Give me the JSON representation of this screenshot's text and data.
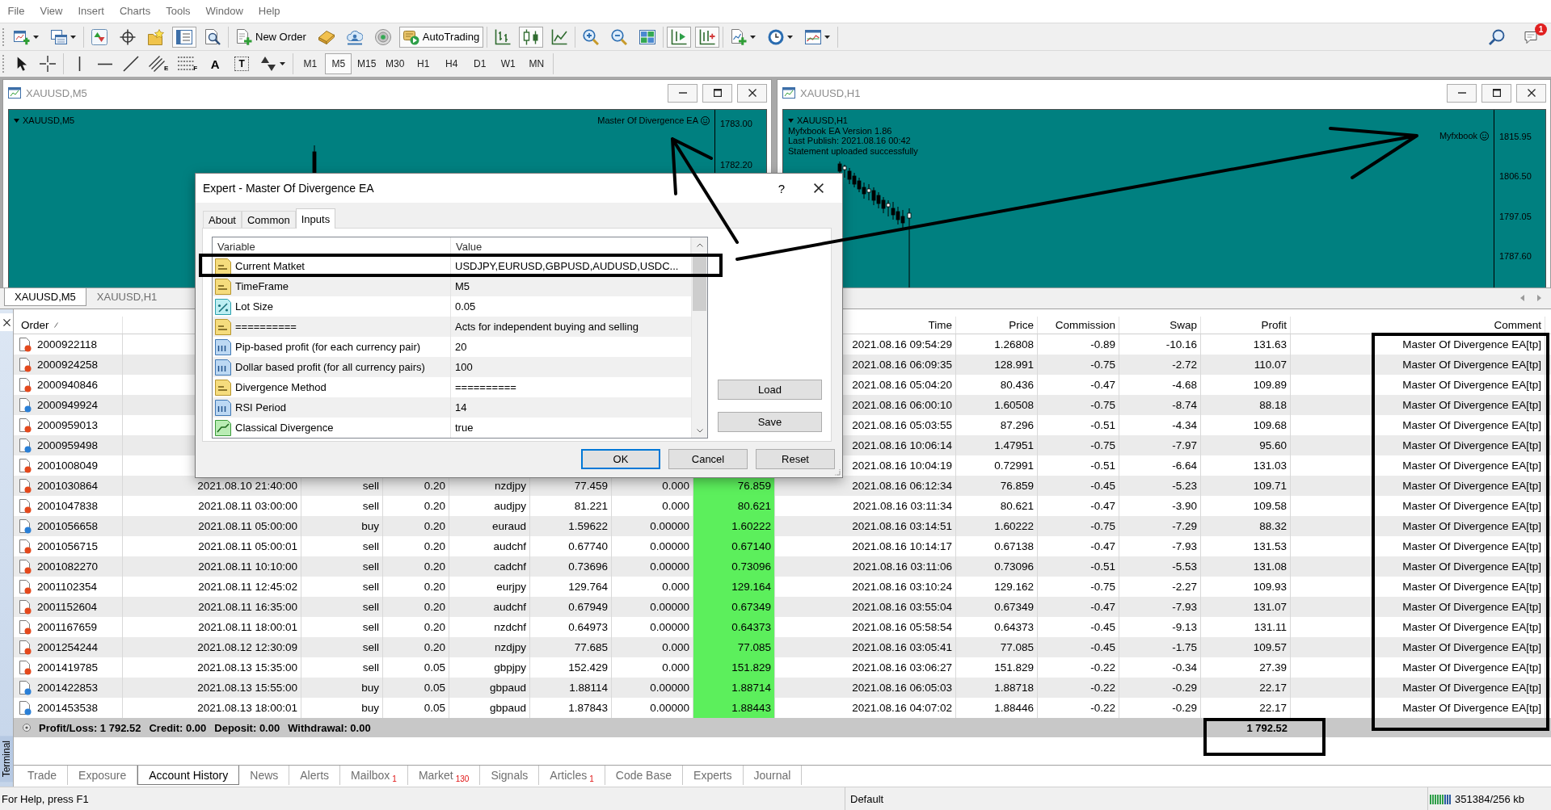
{
  "menu": [
    "File",
    "View",
    "Insert",
    "Charts",
    "Tools",
    "Window",
    "Help"
  ],
  "toolbar": {
    "groups": [
      [
        {
          "kind": "new-chart",
          "menu": true,
          "pressed": false
        },
        {
          "kind": "profiles",
          "menu": true,
          "pressed": false
        }
      ],
      [
        {
          "kind": "market-watch",
          "pressed": false
        },
        {
          "kind": "data-window",
          "pressed": false
        },
        {
          "kind": "navigator",
          "pressed": false
        },
        {
          "kind": "terminal",
          "pressed": true
        },
        {
          "kind": "tester",
          "pressed": false
        }
      ],
      [
        {
          "kind": "new-order",
          "label": "New Order",
          "pressed": false
        },
        {
          "kind": "editor",
          "pressed": false
        },
        {
          "kind": "signals",
          "pressed": false
        },
        {
          "kind": "radar",
          "pressed": false
        },
        {
          "kind": "autotrading",
          "label": "AutoTrading",
          "pressed": true
        }
      ],
      [
        {
          "kind": "bar-chart",
          "pressed": false
        },
        {
          "kind": "candles",
          "pressed": true
        },
        {
          "kind": "line-chart",
          "pressed": false
        }
      ],
      [
        {
          "kind": "zoom-in",
          "pressed": false
        },
        {
          "kind": "zoom-out",
          "pressed": false
        },
        {
          "kind": "tile",
          "pressed": false
        }
      ],
      [
        {
          "kind": "auto-scroll",
          "pressed": true
        },
        {
          "kind": "chart-shift",
          "pressed": true
        }
      ],
      [
        {
          "kind": "indicators",
          "menu": true,
          "pressed": false
        },
        {
          "kind": "periods",
          "menu": true,
          "pressed": false
        },
        {
          "kind": "templates",
          "menu": true,
          "pressed": false
        }
      ]
    ],
    "right": [
      {
        "kind": "search"
      },
      {
        "kind": "notifications",
        "badge": "1"
      }
    ]
  },
  "drawing_tools": {
    "groups": [
      [
        {
          "kind": "cursor"
        },
        {
          "kind": "crosshair"
        }
      ],
      [
        {
          "kind": "vertical-line"
        },
        {
          "kind": "horizontal-line"
        },
        {
          "kind": "trend-line"
        },
        {
          "kind": "channel",
          "glyph": "E"
        },
        {
          "kind": "fibonacci",
          "glyph": "F"
        },
        {
          "kind": "text",
          "glyph": "A"
        },
        {
          "kind": "label",
          "glyph": "T"
        },
        {
          "kind": "arrows",
          "menu": true
        }
      ]
    ]
  },
  "timeframes": [
    {
      "label": "M1",
      "selected": false
    },
    {
      "label": "M5",
      "selected": true
    },
    {
      "label": "M15",
      "selected": false
    },
    {
      "label": "M30",
      "selected": false
    },
    {
      "label": "H1",
      "selected": false
    },
    {
      "label": "H4",
      "selected": false
    },
    {
      "label": "D1",
      "selected": false
    },
    {
      "label": "W1",
      "selected": false
    },
    {
      "label": "MN",
      "selected": false
    }
  ],
  "chart_windows": [
    {
      "title": "XAUUSD,M5",
      "symbol": "XAUUSD,M5",
      "expert": "Master Of Divergence EA",
      "price_labels": [
        "1783.00",
        "1782.20"
      ]
    },
    {
      "title": "XAUUSD,H1",
      "symbol": "XAUUSD,H1",
      "info_lines": [
        "Myfxbook EA Version 1.86",
        "Last Publish: 2021.08.16 00:42",
        "Statement uploaded successfully"
      ],
      "expert": "Myfxbook",
      "price_labels": [
        "1815.95",
        "1806.50",
        "1797.05",
        "1787.60"
      ]
    }
  ],
  "chart_tabs": [
    {
      "label": "XAUUSD,M5",
      "selected": true
    },
    {
      "label": "XAUUSD,H1",
      "selected": false
    }
  ],
  "terminal": {
    "title": "Terminal",
    "columns": [
      {
        "kind": "order",
        "label": "Order",
        "sorted": true
      },
      {
        "kind": "close_time",
        "label": "Time",
        "sorted": false
      },
      {
        "kind": "close_price",
        "label": "Price",
        "sorted": false
      },
      {
        "kind": "commission",
        "label": "Commission",
        "sorted": false
      },
      {
        "kind": "swap",
        "label": "Swap",
        "sorted": false
      },
      {
        "kind": "profit",
        "label": "Profit",
        "sorted": false
      },
      {
        "kind": "comment",
        "label": "Comment",
        "sorted": false
      }
    ],
    "rows": [
      {
        "order": "2000922118",
        "color": "#e4491d",
        "close_time": "2021.08.16 09:54:29",
        "close_price": "1.26808",
        "commission": "-0.89",
        "swap": "-10.16",
        "profit": "131.63",
        "comment": "Master Of Divergence EA[tp]"
      },
      {
        "order": "2000924258",
        "color": "#e4491d",
        "close_time": "2021.08.16 06:09:35",
        "close_price": "128.991",
        "commission": "-0.75",
        "swap": "-2.72",
        "profit": "110.07",
        "comment": "Master Of Divergence EA[tp]"
      },
      {
        "order": "2000940846",
        "color": "#e4491d",
        "close_time": "2021.08.16 05:04:20",
        "close_price": "80.436",
        "commission": "-0.47",
        "swap": "-4.68",
        "profit": "109.89",
        "comment": "Master Of Divergence EA[tp]"
      },
      {
        "order": "2000949924",
        "color": "#2a7fd6",
        "close_time": "2021.08.16 06:00:10",
        "close_price": "1.60508",
        "commission": "-0.75",
        "swap": "-8.74",
        "profit": "88.18",
        "comment": "Master Of Divergence EA[tp]"
      },
      {
        "order": "2000959013",
        "color": "#e4491d",
        "close_time": "2021.08.16 05:03:55",
        "close_price": "87.296",
        "commission": "-0.51",
        "swap": "-4.34",
        "profit": "109.68",
        "comment": "Master Of Divergence EA[tp]"
      },
      {
        "order": "2000959498",
        "color": "#2a7fd6",
        "close_time": "2021.08.16 10:06:14",
        "close_price": "1.47951",
        "commission": "-0.75",
        "swap": "-7.97",
        "profit": "95.60",
        "comment": "Master Of Divergence EA[tp]"
      },
      {
        "order": "2001008049",
        "color": "#e4491d",
        "close_time": "2021.08.16 10:04:19",
        "close_price": "0.72991",
        "commission": "-0.51",
        "swap": "-6.64",
        "profit": "131.03",
        "comment": "Master Of Divergence EA[tp]"
      },
      {
        "order": "2001030864",
        "color": "#e4491d",
        "open_time": "2021.08.10 21:40:00",
        "type": "sell",
        "size": "0.20",
        "symbol": "nzdjpy",
        "price": "77.459",
        "sl": "0.000",
        "tp": "76.859",
        "close_time": "2021.08.16 06:12:34",
        "close_price": "76.859",
        "commission": "-0.45",
        "swap": "-5.23",
        "profit": "109.71",
        "comment": "Master Of Divergence EA[tp]"
      },
      {
        "order": "2001047838",
        "color": "#e4491d",
        "open_time": "2021.08.11 03:00:00",
        "type": "sell",
        "size": "0.20",
        "symbol": "audjpy",
        "price": "81.221",
        "sl": "0.000",
        "tp": "80.621",
        "close_time": "2021.08.16 03:11:34",
        "close_price": "80.621",
        "commission": "-0.47",
        "swap": "-3.90",
        "profit": "109.58",
        "comment": "Master Of Divergence EA[tp]"
      },
      {
        "order": "2001056658",
        "color": "#2a7fd6",
        "open_time": "2021.08.11 05:00:00",
        "type": "buy",
        "size": "0.20",
        "symbol": "euraud",
        "price": "1.59622",
        "sl": "0.00000",
        "tp": "1.60222",
        "close_time": "2021.08.16 03:14:51",
        "close_price": "1.60222",
        "commission": "-0.75",
        "swap": "-7.29",
        "profit": "88.32",
        "comment": "Master Of Divergence EA[tp]"
      },
      {
        "order": "2001056715",
        "color": "#e4491d",
        "open_time": "2021.08.11 05:00:01",
        "type": "sell",
        "size": "0.20",
        "symbol": "audchf",
        "price": "0.67740",
        "sl": "0.00000",
        "tp": "0.67140",
        "close_time": "2021.08.16 10:14:17",
        "close_price": "0.67138",
        "commission": "-0.47",
        "swap": "-7.93",
        "profit": "131.53",
        "comment": "Master Of Divergence EA[tp]"
      },
      {
        "order": "2001082270",
        "color": "#e4491d",
        "open_time": "2021.08.11 10:10:00",
        "type": "sell",
        "size": "0.20",
        "symbol": "cadchf",
        "price": "0.73696",
        "sl": "0.00000",
        "tp": "0.73096",
        "close_time": "2021.08.16 03:11:06",
        "close_price": "0.73096",
        "commission": "-0.51",
        "swap": "-5.53",
        "profit": "131.08",
        "comment": "Master Of Divergence EA[tp]"
      },
      {
        "order": "2001102354",
        "color": "#e4491d",
        "open_time": "2021.08.11 12:45:02",
        "type": "sell",
        "size": "0.20",
        "symbol": "eurjpy",
        "price": "129.764",
        "sl": "0.000",
        "tp": "129.164",
        "close_time": "2021.08.16 03:10:24",
        "close_price": "129.162",
        "commission": "-0.75",
        "swap": "-2.27",
        "profit": "109.93",
        "comment": "Master Of Divergence EA[tp]"
      },
      {
        "order": "2001152604",
        "color": "#e4491d",
        "open_time": "2021.08.11 16:35:00",
        "type": "sell",
        "size": "0.20",
        "symbol": "audchf",
        "price": "0.67949",
        "sl": "0.00000",
        "tp": "0.67349",
        "close_time": "2021.08.16 03:55:04",
        "close_price": "0.67349",
        "commission": "-0.47",
        "swap": "-7.93",
        "profit": "131.07",
        "comment": "Master Of Divergence EA[tp]"
      },
      {
        "order": "2001167659",
        "color": "#e4491d",
        "open_time": "2021.08.11 18:00:01",
        "type": "sell",
        "size": "0.20",
        "symbol": "nzdchf",
        "price": "0.64973",
        "sl": "0.00000",
        "tp": "0.64373",
        "close_time": "2021.08.16 05:58:54",
        "close_price": "0.64373",
        "commission": "-0.45",
        "swap": "-9.13",
        "profit": "131.11",
        "comment": "Master Of Divergence EA[tp]"
      },
      {
        "order": "2001254244",
        "color": "#e4491d",
        "open_time": "2021.08.12 12:30:09",
        "type": "sell",
        "size": "0.20",
        "symbol": "nzdjpy",
        "price": "77.685",
        "sl": "0.000",
        "tp": "77.085",
        "close_time": "2021.08.16 03:05:41",
        "close_price": "77.085",
        "commission": "-0.45",
        "swap": "-1.75",
        "profit": "109.57",
        "comment": "Master Of Divergence EA[tp]"
      },
      {
        "order": "2001419785",
        "color": "#e4491d",
        "open_time": "2021.08.13 15:35:00",
        "type": "sell",
        "size": "0.05",
        "symbol": "gbpjpy",
        "price": "152.429",
        "sl": "0.000",
        "tp": "151.829",
        "close_time": "2021.08.16 03:06:27",
        "close_price": "151.829",
        "commission": "-0.22",
        "swap": "-0.34",
        "profit": "27.39",
        "comment": "Master Of Divergence EA[tp]"
      },
      {
        "order": "2001422853",
        "color": "#2a7fd6",
        "open_time": "2021.08.13 15:55:00",
        "type": "buy",
        "size": "0.05",
        "symbol": "gbpaud",
        "price": "1.88114",
        "sl": "0.00000",
        "tp": "1.88714",
        "close_time": "2021.08.16 06:05:03",
        "close_price": "1.88718",
        "commission": "-0.22",
        "swap": "-0.29",
        "profit": "22.17",
        "comment": "Master Of Divergence EA[tp]"
      },
      {
        "order": "2001453538",
        "color": "#2a7fd6",
        "open_time": "2021.08.13 18:00:01",
        "type": "buy",
        "size": "0.05",
        "symbol": "gbpaud",
        "price": "1.87843",
        "sl": "0.00000",
        "tp": "1.88443",
        "close_time": "2021.08.16 04:07:02",
        "close_price": "1.88446",
        "commission": "-0.22",
        "swap": "-0.29",
        "profit": "22.17",
        "comment": "Master Of Divergence EA[tp]"
      }
    ],
    "summary": {
      "items": [
        "Profit/Loss: 1 792.52",
        "Credit: 0.00",
        "Deposit: 0.00",
        "Withdrawal: 0.00"
      ],
      "total": "1 792.52"
    },
    "tabs": [
      {
        "label": "Trade",
        "selected": false
      },
      {
        "label": "Exposure",
        "selected": false
      },
      {
        "label": "Account History",
        "selected": true
      },
      {
        "label": "News",
        "selected": false
      },
      {
        "label": "Alerts",
        "selected": false
      },
      {
        "label": "Mailbox",
        "count": "1",
        "selected": false
      },
      {
        "label": "Market",
        "count": "130",
        "selected": false
      },
      {
        "label": "Signals",
        "selected": false
      },
      {
        "label": "Articles",
        "count": "1",
        "selected": false
      },
      {
        "label": "Code Base",
        "selected": false
      },
      {
        "label": "Experts",
        "selected": false
      },
      {
        "label": "Journal",
        "selected": false
      }
    ]
  },
  "dialog": {
    "title": "Expert - Master Of Divergence EA",
    "help": "?",
    "tabs": [
      {
        "label": "About",
        "selected": false
      },
      {
        "label": "Common",
        "selected": false
      },
      {
        "label": "Inputs",
        "selected": true
      }
    ],
    "headers": [
      "Variable",
      "Value"
    ],
    "inputs": [
      {
        "kind": "string",
        "name": "Current Matket",
        "value": "USDJPY,EURUSD,GBPUSD,AUDUSD,USDC..."
      },
      {
        "kind": "string",
        "name": "TimeFrame",
        "value": "M5"
      },
      {
        "kind": "double",
        "name": "Lot Size",
        "value": "0.05"
      },
      {
        "kind": "string",
        "name": "==========",
        "value": "Acts for independent buying and selling"
      },
      {
        "kind": "int",
        "name": "Pip-based profit (for each currency pair)",
        "value": "20"
      },
      {
        "kind": "int",
        "name": "Dollar based profit (for all currency pairs)",
        "value": "100"
      },
      {
        "kind": "string",
        "name": "Divergence Method",
        "value": "=========="
      },
      {
        "kind": "int",
        "name": "RSI Period",
        "value": "14"
      },
      {
        "kind": "bool",
        "name": "Classical Divergence",
        "value": "true"
      }
    ],
    "side_buttons": [
      "Load",
      "Save"
    ],
    "buttons": [
      {
        "label": "OK",
        "focused": true
      },
      {
        "label": "Cancel",
        "focused": false
      },
      {
        "label": "Reset",
        "focused": false
      }
    ]
  },
  "status_bar": {
    "help": "For Help, press F1",
    "profile": "Default",
    "traffic": "351384/256 kb"
  },
  "annotations": [
    {
      "kind": "box"
    },
    {
      "kind": "arrow"
    },
    {
      "kind": "arrow"
    },
    {
      "kind": "box"
    },
    {
      "kind": "box"
    }
  ]
}
